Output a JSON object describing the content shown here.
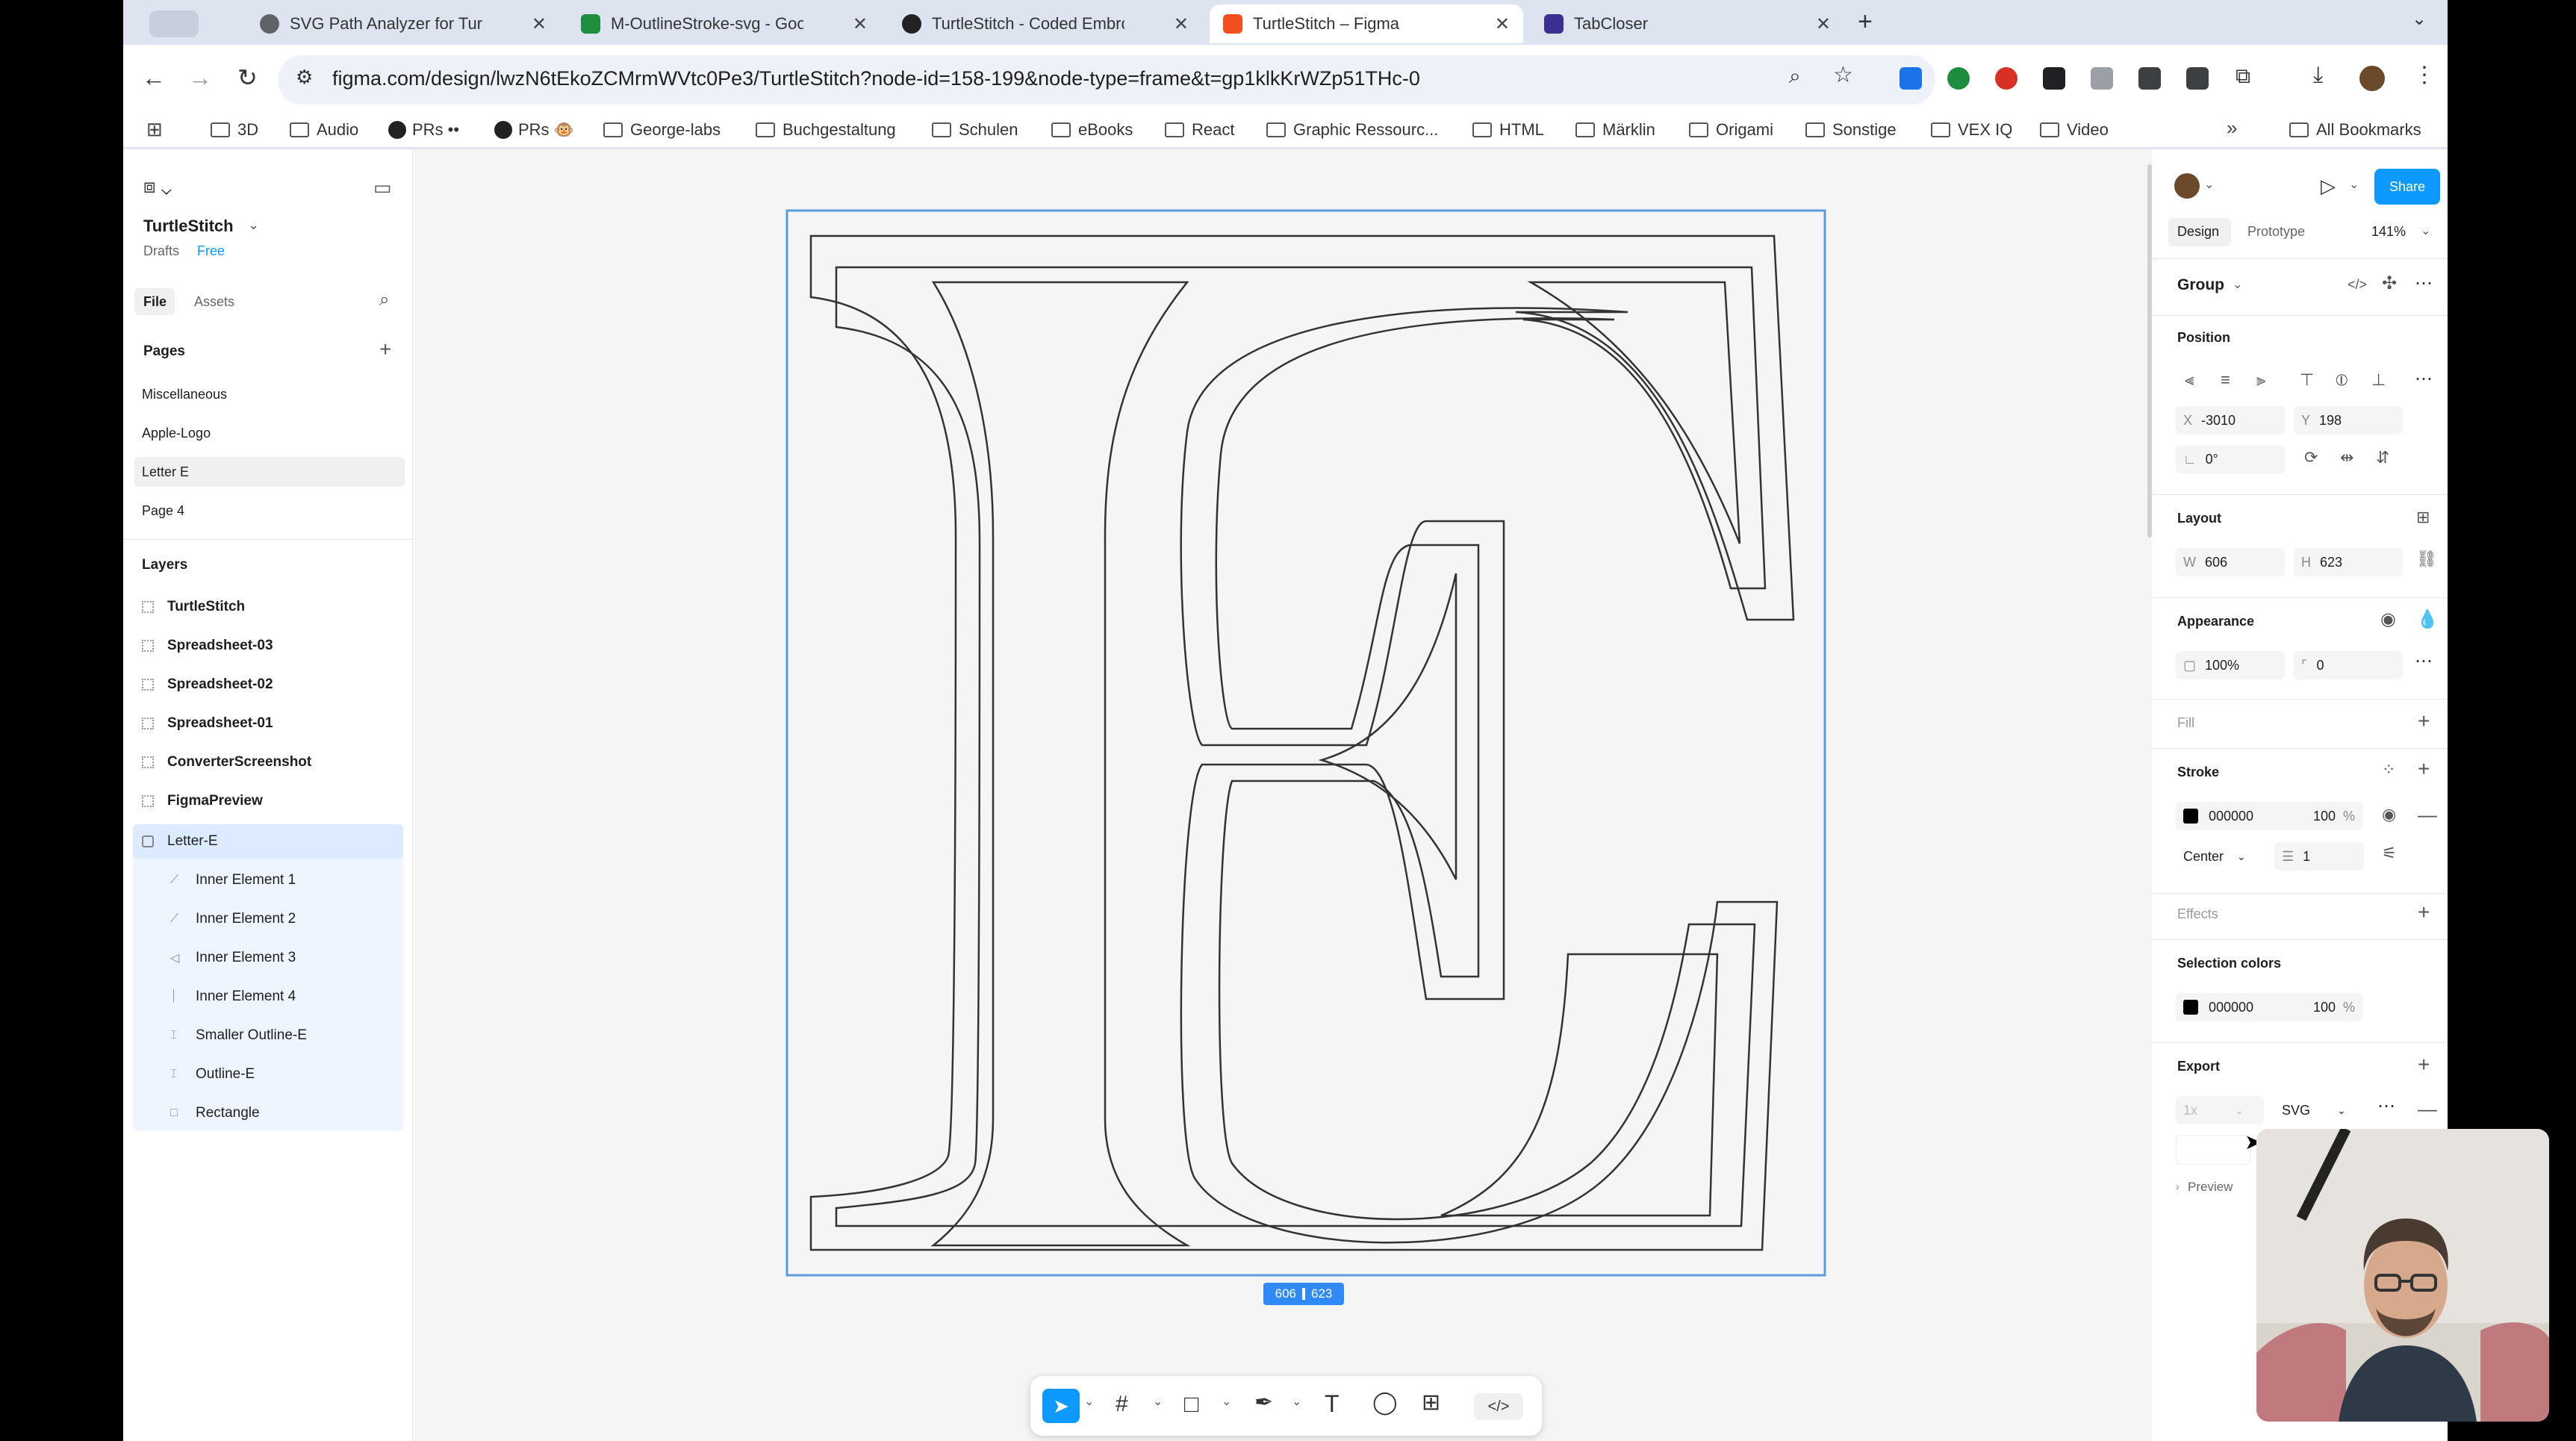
{
  "browser": {
    "tabs": [
      {
        "title": "SVG Path Analyzer for Turtle",
        "icon": "globe-icon",
        "color": "#5f6368"
      },
      {
        "title": "M-OutlineStroke-svg - Googl",
        "icon": "sheets-icon",
        "color": "#1e8e3e"
      },
      {
        "title": "TurtleStitch - Coded Embroid",
        "icon": "github-icon",
        "color": "#222222"
      },
      {
        "title": "TurtleStitch – Figma",
        "icon": "figma-icon",
        "color": "#f24e1e"
      },
      {
        "title": "TabCloser",
        "icon": "tabcloser-icon",
        "color": "#3b2f8f"
      }
    ],
    "url": "figma.com/design/lwzN6tEkoZCMrmWVtc0Pe3/TurtleStitch?node-id=158-199&node-type=frame&t=gp1klkKrWZp51THc-0",
    "bookmarks": [
      "3D",
      "Audio",
      "PRs ••",
      "PRs 🐵",
      "George-labs",
      "Buchgestaltung",
      "Schulen",
      "eBooks",
      "React",
      "Graphic Ressourc...",
      "HTML",
      "Märklin",
      "Origami",
      "Sonstige",
      "VEX IQ",
      "Video"
    ],
    "all_bookmarks": "All Bookmarks"
  },
  "file": {
    "name": "TurtleStitch",
    "drafts": "Drafts",
    "plan": "Free",
    "tab_file": "File",
    "tab_assets": "Assets"
  },
  "pages": {
    "heading": "Pages",
    "items": [
      "Miscellaneous",
      "Apple-Logo",
      "Letter E",
      "Page 4"
    ]
  },
  "layers": {
    "heading": "Layers",
    "items": [
      "TurtleStitch",
      "Spreadsheet-03",
      "Spreadsheet-02",
      "Spreadsheet-01",
      "ConverterScreenshot",
      "FigmaPreview",
      "Letter-E"
    ],
    "children": [
      "Inner Element 1",
      "Inner Element 2",
      "Inner Element 3",
      "Inner Element 4",
      "Smaller Outline-E",
      "Outline-E",
      "Rectangle"
    ]
  },
  "canvas": {
    "dimension_badge_w": "606",
    "dimension_badge_h": "623"
  },
  "design_panel": {
    "share": "Share",
    "tab_design": "Design",
    "tab_prototype": "Prototype",
    "zoom": "141%",
    "selection_type": "Group",
    "position_heading": "Position",
    "x_label": "X",
    "x_value": "-3010",
    "y_label": "Y",
    "y_value": "198",
    "rotation": "0°",
    "layout_heading": "Layout",
    "w_label": "W",
    "w_value": "606",
    "h_label": "H",
    "h_value": "623",
    "appearance_heading": "Appearance",
    "opacity": "100%",
    "corner_radius": "0",
    "fill_heading": "Fill",
    "stroke_heading": "Stroke",
    "stroke_color": "000000",
    "stroke_opacity": "100",
    "stroke_pct": "%",
    "stroke_align": "Center",
    "stroke_width": "1",
    "effects_heading": "Effects",
    "selection_colors_heading": "Selection colors",
    "sel_color": "000000",
    "sel_opacity": "100",
    "sel_pct": "%",
    "export_heading": "Export",
    "export_scale": "1x",
    "export_format": "SVG",
    "preview": "Preview"
  }
}
